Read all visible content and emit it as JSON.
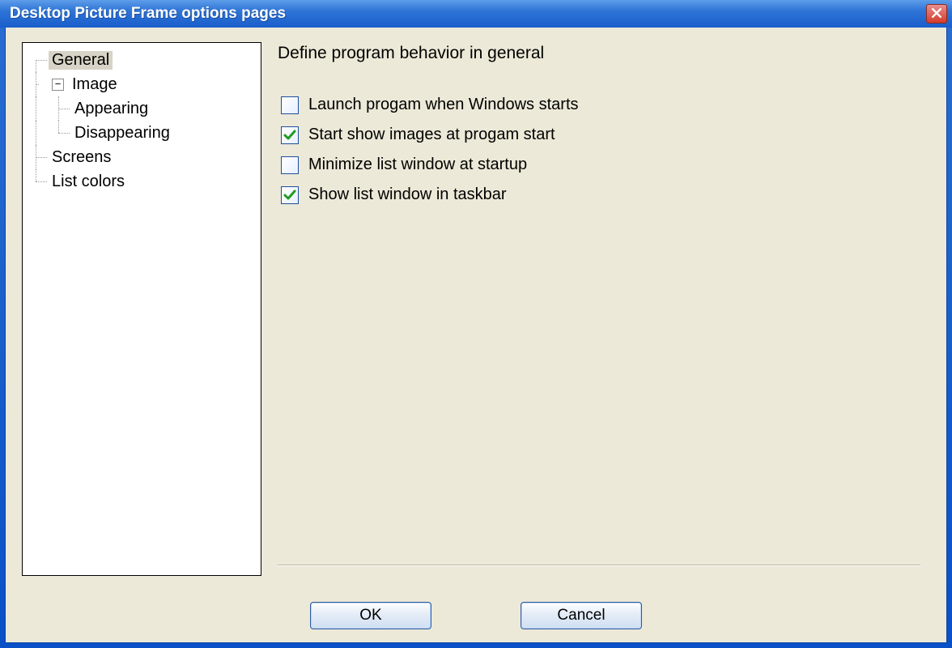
{
  "window": {
    "title": "Desktop Picture Frame options pages",
    "close_icon": "close-icon"
  },
  "tree": {
    "items": [
      {
        "label": "General",
        "depth": 0,
        "selected": true,
        "expando": null
      },
      {
        "label": "Image",
        "depth": 0,
        "selected": false,
        "expando": "−"
      },
      {
        "label": "Appearing",
        "depth": 1,
        "selected": false,
        "expando": null
      },
      {
        "label": "Disappearing",
        "depth": 1,
        "selected": false,
        "expando": null
      },
      {
        "label": "Screens",
        "depth": 0,
        "selected": false,
        "expando": null
      },
      {
        "label": "List colors",
        "depth": 0,
        "selected": false,
        "expando": null
      }
    ]
  },
  "panel": {
    "heading": "Define program behavior in general",
    "options": [
      {
        "label": "Launch progam when Windows starts",
        "checked": false
      },
      {
        "label": "Start show images at progam start",
        "checked": true
      },
      {
        "label": "Minimize list window at startup",
        "checked": false
      },
      {
        "label": "Show list window in taskbar",
        "checked": true
      }
    ]
  },
  "buttons": {
    "ok_label": "OK",
    "cancel_label": "Cancel"
  }
}
